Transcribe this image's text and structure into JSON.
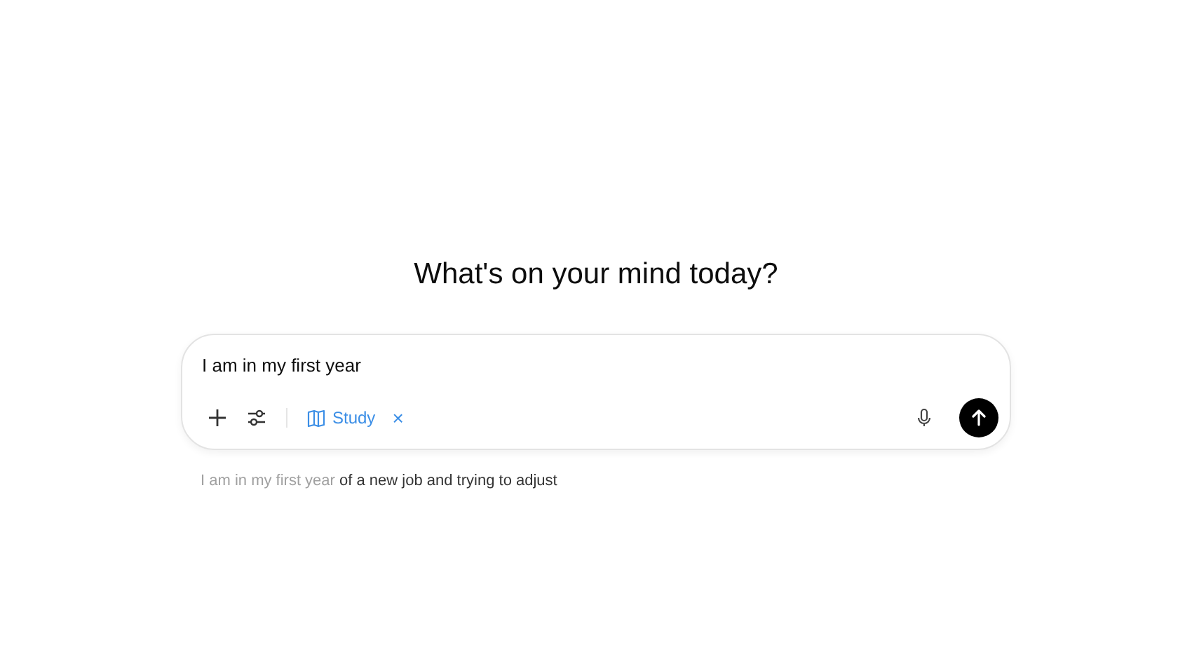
{
  "heading": "What's on your mind today?",
  "composer": {
    "value": "I am in my first year",
    "tool_chip": {
      "label": "Study",
      "close": "×"
    }
  },
  "suggestions": [
    {
      "typed": "I am in my first year",
      "completion": " of a new job and trying to adjust"
    }
  ]
}
